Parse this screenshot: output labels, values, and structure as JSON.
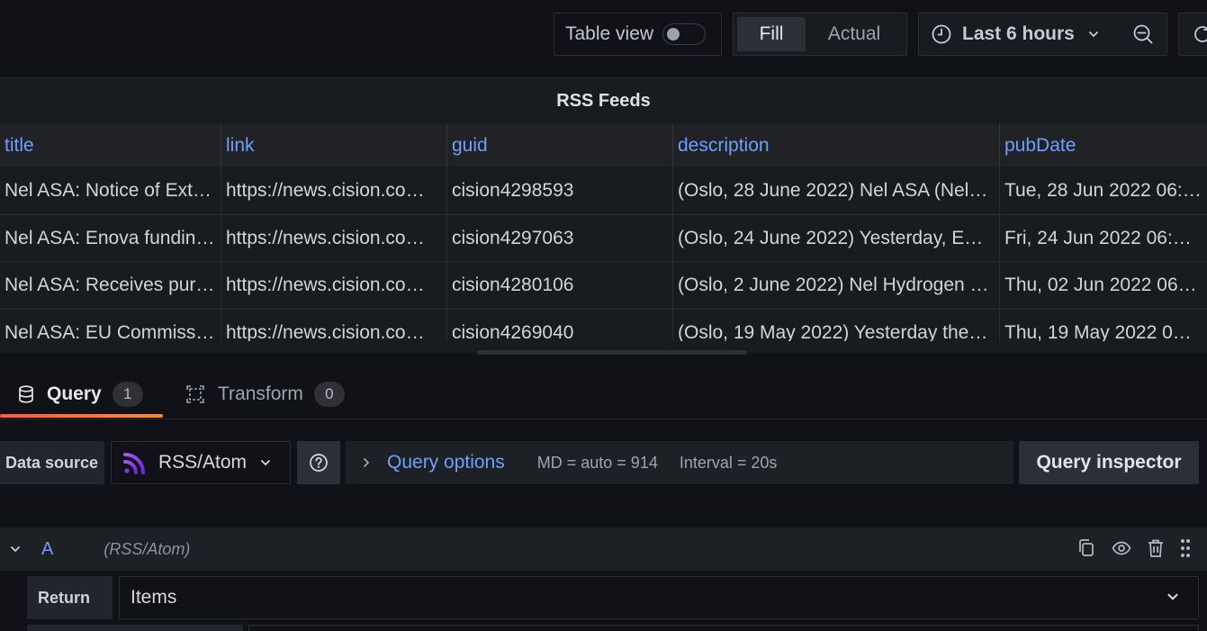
{
  "toolbar": {
    "table_view_label": "Table view",
    "table_view_on": false,
    "fill_label": "Fill",
    "actual_label": "Actual",
    "time_range_label": "Last 6 hours"
  },
  "panel": {
    "title": "RSS Feeds",
    "columns": [
      "title",
      "link",
      "guid",
      "description",
      "pubDate"
    ],
    "rows": [
      [
        "Nel ASA: Notice of Ext…",
        "https://news.cision.co…",
        "cision4298593",
        "(Oslo, 28 June 2022) Nel ASA (Nel…",
        "Tue, 28 Jun 2022 06:…"
      ],
      [
        "Nel ASA: Enova fundin…",
        "https://news.cision.co…",
        "cision4297063",
        "(Oslo, 24 June 2022) Yesterday, E…",
        "Fri, 24 Jun 2022 06:5…"
      ],
      [
        "Nel ASA: Receives pur…",
        "https://news.cision.co…",
        "cision4280106",
        "(Oslo, 2 June 2022) Nel Hydrogen …",
        "Thu, 02 Jun 2022 06:…"
      ],
      [
        "Nel ASA: EU Commissi…",
        "https://news.cision.co…",
        "cision4269040",
        "(Oslo, 19 May 2022) Yesterday the…",
        "Thu, 19 May 2022 06…"
      ]
    ]
  },
  "tabs": {
    "query_label": "Query",
    "query_count": "1",
    "transform_label": "Transform",
    "transform_count": "0"
  },
  "query_row": {
    "data_source_label": "Data source",
    "data_source_value": "RSS/Atom",
    "query_options_label": "Query options",
    "md_text": "MD = auto = 914",
    "interval_text": "Interval = 20s",
    "inspector_label": "Query inspector"
  },
  "query_a": {
    "ref_id": "A",
    "datasource_name": "(RSS/Atom)",
    "return_label": "Return",
    "return_value": "Items"
  },
  "colors": {
    "background": "#111217",
    "panel": "#181b1f",
    "link_blue": "#6e9fff",
    "tab_accent": "#ff8833",
    "rss_icon": "#8b5cf6"
  }
}
